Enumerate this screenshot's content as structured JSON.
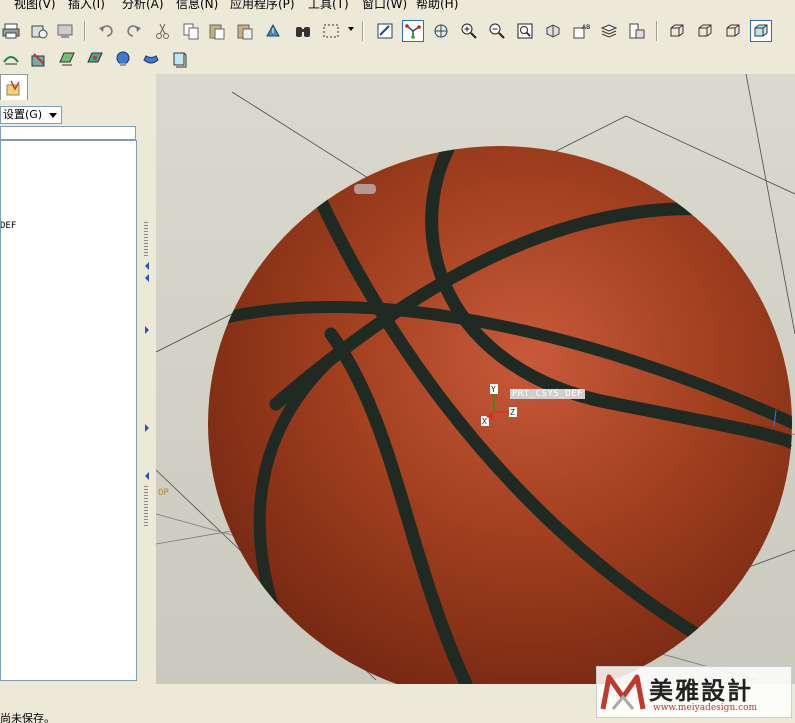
{
  "menubar": {
    "items": [
      {
        "label": "视图(V)"
      },
      {
        "label": "插入(I)"
      },
      {
        "label": "分析(A)"
      },
      {
        "label": "信息(N)"
      },
      {
        "label": "应用程序(P)"
      },
      {
        "label": "工具(T)"
      },
      {
        "label": "窗口(W)"
      },
      {
        "label": "帮助(H)"
      }
    ]
  },
  "toolbar1": {
    "icons": [
      "print-icon",
      "email-icon",
      "close-window-icon",
      "undo-icon",
      "redo-icon",
      "cut-icon",
      "copy-icon",
      "paste-icon",
      "paste-special-icon",
      "find-icon",
      "regenerate-icon",
      "select-box-icon",
      "repaint-icon",
      "spin-center-icon",
      "orient-icon",
      "zoom-in-icon",
      "zoom-out-icon",
      "refit-icon",
      "saved-views-icon",
      "annotation-icon",
      "layers-icon",
      "model-tree-icon",
      "wireframe-icon",
      "hidden-line-icon",
      "no-hidden-icon",
      "shading-icon"
    ]
  },
  "toolbar2": {
    "icons": [
      "datum-display-icon",
      "axis-display-icon",
      "plane-display-icon",
      "point-display-icon",
      "csys-display-icon",
      "appearance-icon",
      "view-manager-icon"
    ]
  },
  "left_panel": {
    "settings_label": "设置(G)",
    "tree_partial_text": "DEF"
  },
  "viewport": {
    "csys_label": "PRT_CSYS_DEF",
    "axis_x": "X",
    "axis_y": "Y",
    "axis_z": "Z",
    "datum_label": "OP",
    "colors": {
      "background": "#cfcfc4",
      "ball": "#9a3a1f",
      "seams": "#1f2b22"
    }
  },
  "status": {
    "message": "尚未保存。"
  },
  "watermark": {
    "name": "美雅設計",
    "url": "www.meiyadesign.com"
  }
}
